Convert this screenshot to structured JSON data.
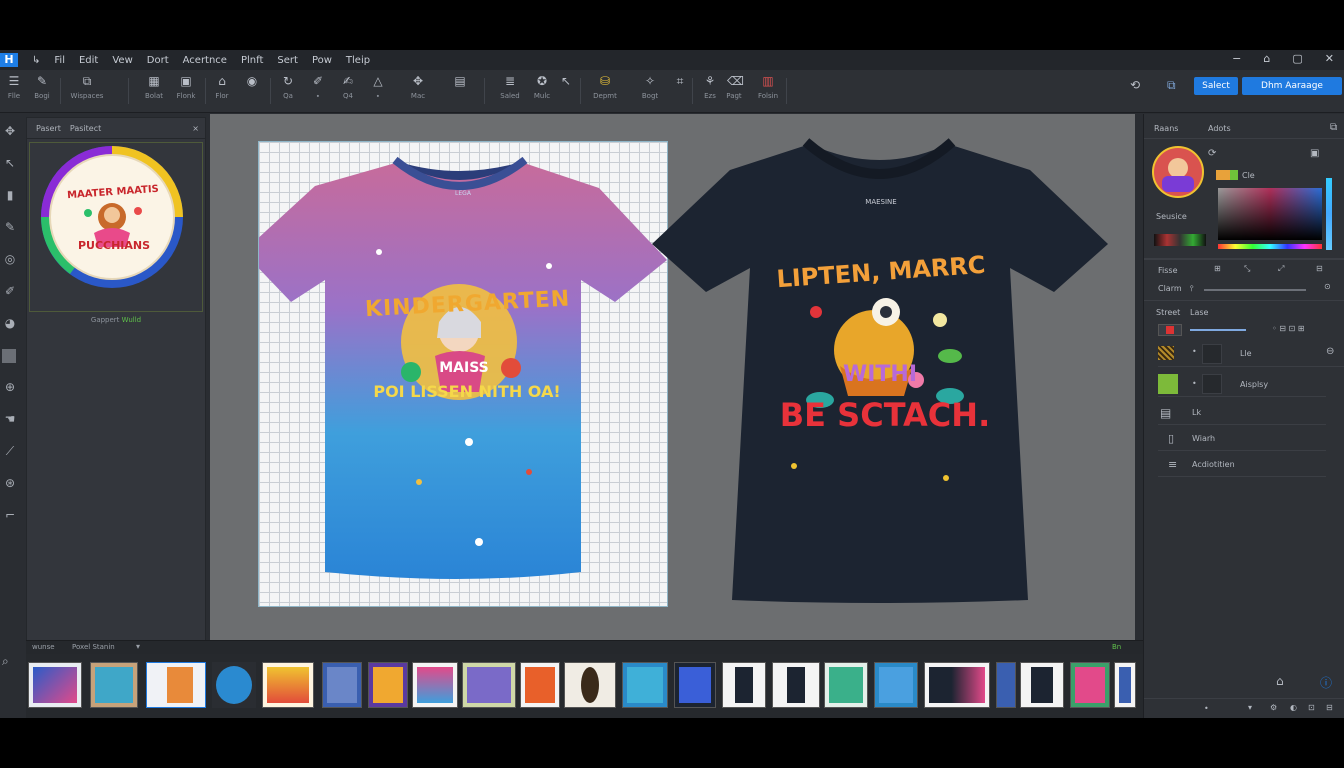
{
  "menu": {
    "logo": "H",
    "items": [
      "Fil",
      "Edit",
      "Vew",
      "Dort",
      "Acertnce",
      "Plnft",
      "Sert",
      "Pow",
      "Tleip"
    ]
  },
  "window_controls": [
    "−",
    "⌂",
    "▢",
    "✕"
  ],
  "toolbar": {
    "tools": [
      {
        "icon": "menu-icon",
        "label": "Flle"
      },
      {
        "icon": "pen-icon",
        "label": "Bogi"
      },
      {
        "icon": "layers-icon",
        "label": "Wispaces"
      },
      {
        "icon": "grid-icon",
        "label": "Bolat"
      },
      {
        "icon": "image-icon",
        "label": "Flonk"
      },
      {
        "icon": "home-icon",
        "label": "Flor"
      },
      {
        "icon": "circle-icon",
        "label": ""
      },
      {
        "icon": "rotate-icon",
        "label": "Qa"
      },
      {
        "icon": "brush-icon",
        "label": "∙"
      },
      {
        "icon": "paint-icon",
        "label": "Q4"
      },
      {
        "icon": "triangle-icon",
        "label": "∙"
      },
      {
        "icon": "shape-icon",
        "label": "Mac"
      },
      {
        "icon": "frame-icon",
        "label": ""
      },
      {
        "icon": "text-icon",
        "label": "Saled"
      },
      {
        "icon": "settings-icon",
        "label": "Mulc"
      },
      {
        "icon": "arrow-icon",
        "label": ""
      },
      {
        "icon": "bucket-icon",
        "label": "Depmt"
      },
      {
        "icon": "wand-icon",
        "label": "Bogt"
      },
      {
        "icon": "crop-icon",
        "label": ""
      },
      {
        "icon": "magic-icon",
        "label": "Ezs"
      },
      {
        "icon": "eraser-icon",
        "label": "Pagt"
      },
      {
        "icon": "layer-icon",
        "label": "Folsin"
      }
    ],
    "select_label": "Salect",
    "arrange_label": "Dhm Aaraage"
  },
  "left_panel": {
    "tab1": "Pasert",
    "tab2": "Pasitect",
    "close": "×",
    "caption_gray": "Gappert",
    "caption_green": "Wulld",
    "badge_top": "MAATER MAATIS",
    "badge_bottom": "PUCCHIANS"
  },
  "canvas": {
    "shirt1": {
      "tag": "LEGA",
      "line1": "KINDERGARTEN",
      "line2": "MAISS",
      "line3": "POI LISSEN NITH OA!"
    },
    "shirt2": {
      "tag": "MAESINE",
      "line1": "LIPTEN, MARRC",
      "line2": "WITHI",
      "line3": "BE SCTACH."
    }
  },
  "right_panel": {
    "tab1": "Raans",
    "tab2": "Adots",
    "swatch_label": "Seusice",
    "color_label": "Cle",
    "row_fisse": "Fisse",
    "row_clarm": "Clarm",
    "row_street": "Street",
    "row_lase": "Lase",
    "layers": [
      {
        "name": "Lle",
        "icon": "hatch-icon"
      },
      {
        "name": "Aisplsy",
        "icon": "green-leaf-icon"
      },
      {
        "name": "Lk",
        "icon": "stack-icon"
      },
      {
        "name": "Wiarh",
        "icon": "doc-icon"
      },
      {
        "name": "Acdiotitien",
        "icon": "list-icon"
      }
    ],
    "accent_blue": "#1f7ae0"
  },
  "bottom": {
    "tab1": "wunse",
    "tab2": "Poxel Stanin",
    "expand": "Bn"
  },
  "colors": {
    "accent": "#1f7ae0",
    "canvas": "#6c6e70",
    "panel": "#2e3136"
  }
}
